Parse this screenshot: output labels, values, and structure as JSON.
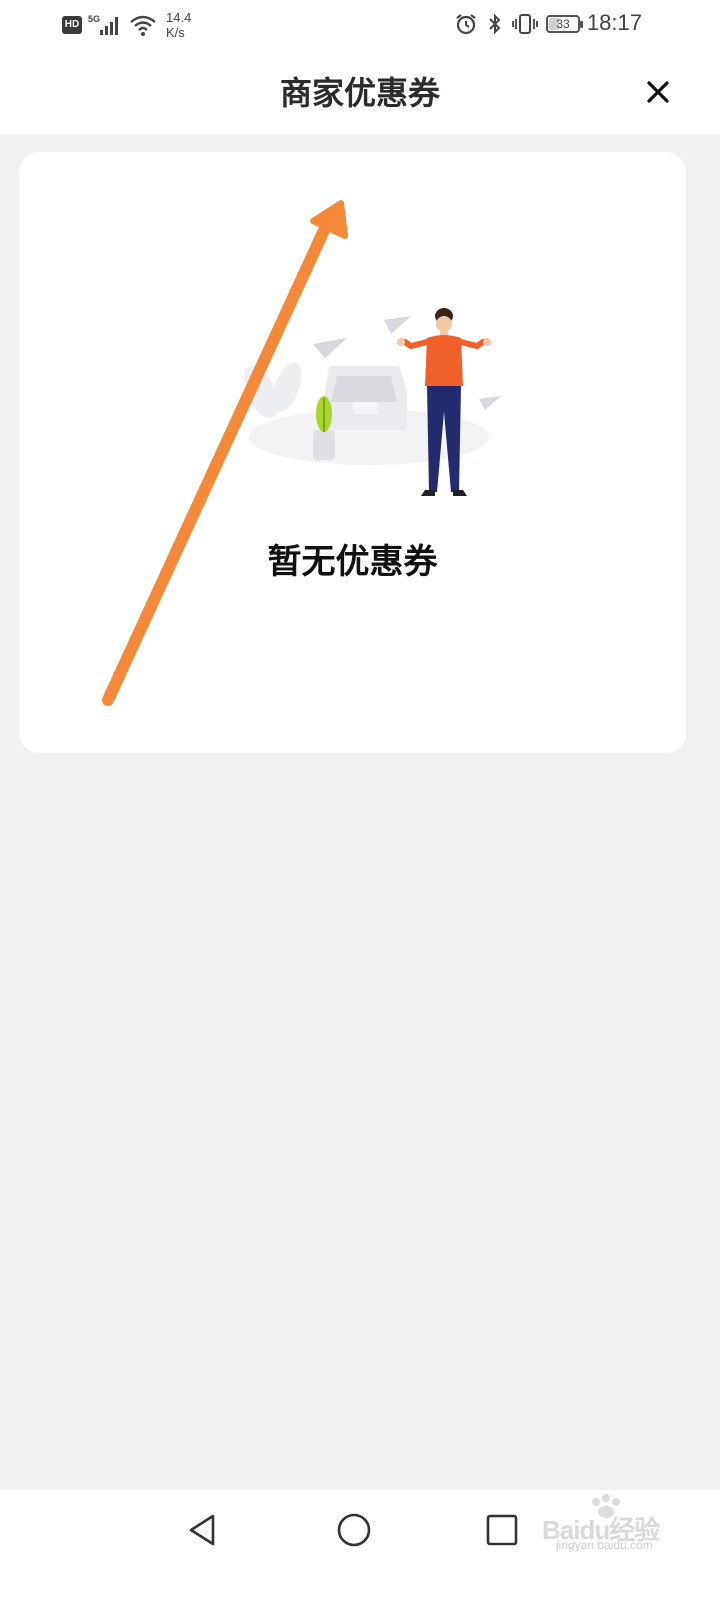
{
  "status_bar": {
    "hd_label": "HD",
    "network_label": "5G",
    "speed_value": "14.4",
    "speed_unit": "K/s",
    "battery_level": "33",
    "time": "18:17"
  },
  "header": {
    "title": "商家优惠券"
  },
  "main": {
    "empty_message": "暂无优惠券"
  },
  "watermark": {
    "brand": "Baidu经验",
    "url": "jingyan.baidu.com"
  },
  "colors": {
    "background": "#f1f1f1",
    "card": "#ffffff",
    "annotation_arrow": "#f5893a",
    "figure_shirt": "#f0602a",
    "figure_pants": "#232a6e",
    "plant": "#a9d62c"
  },
  "icons": {
    "close": "close-icon",
    "back": "back-triangle-icon",
    "home": "home-circle-icon",
    "recent": "recent-square-icon"
  }
}
